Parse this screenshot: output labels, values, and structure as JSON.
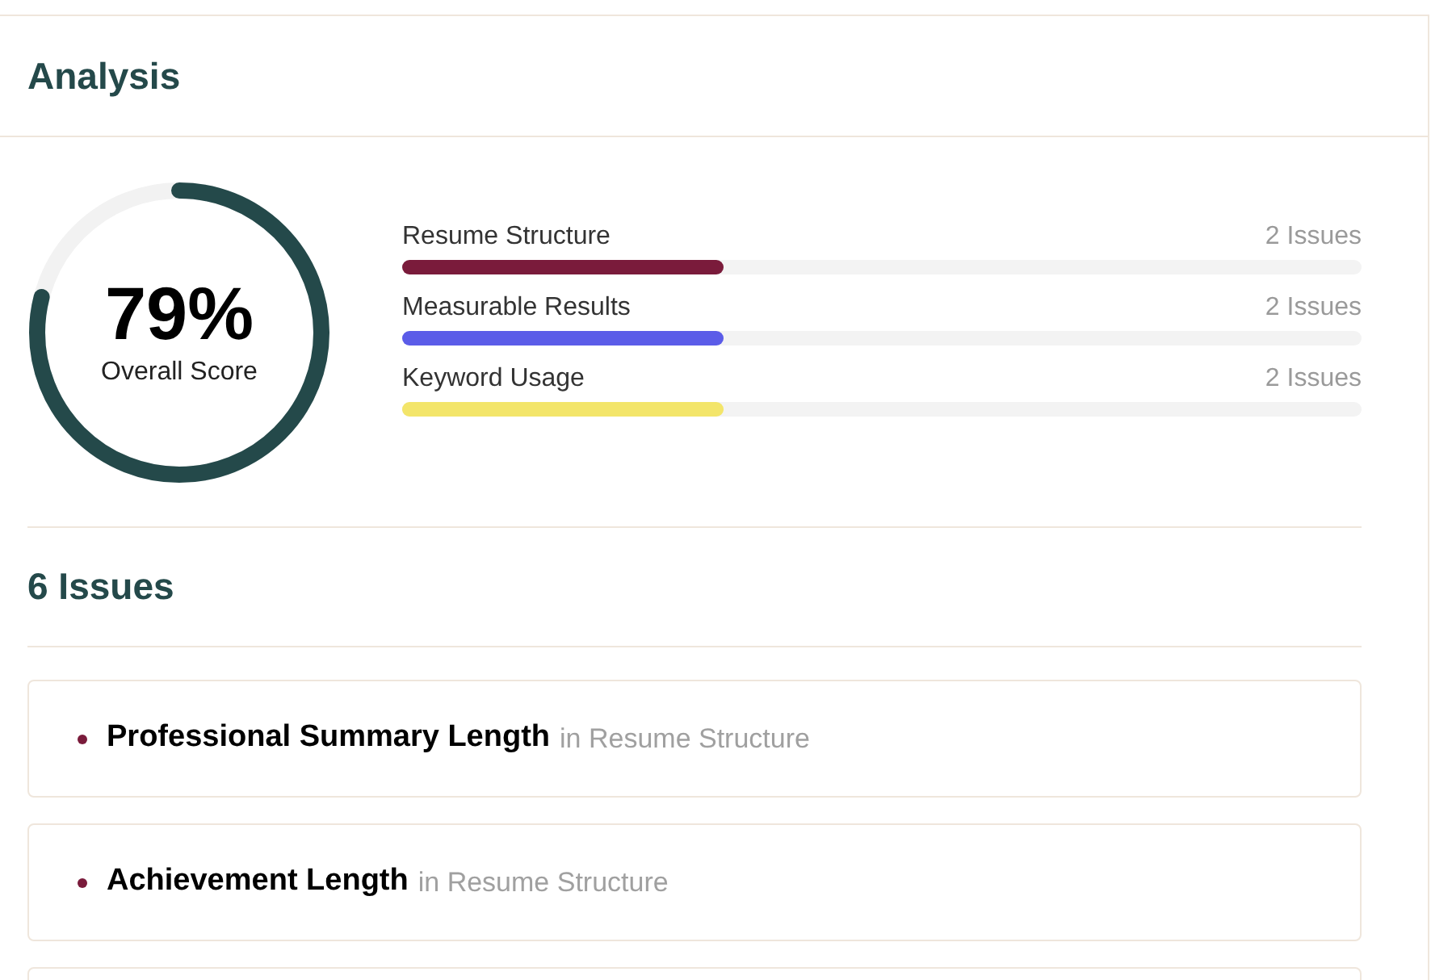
{
  "header": {
    "title": "Analysis"
  },
  "score": {
    "value": "79%",
    "label": "Overall Score",
    "level": 0.79
  },
  "categories": [
    {
      "name": "Resume Structure",
      "issues": "2 Issues",
      "level": 0.335,
      "color": "#7a1b3b"
    },
    {
      "name": "Measurable Results",
      "issues": "2 Issues",
      "level": 0.335,
      "color": "#5b5ce8"
    },
    {
      "name": "Keyword Usage",
      "issues": "2 Issues",
      "level": 0.335,
      "color": "#f3e56a"
    }
  ],
  "issues_heading": "6 Issues",
  "issues": [
    {
      "title": "Professional Summary Length",
      "context": "in Resume Structure",
      "color": "#7a1b3b"
    },
    {
      "title": "Achievement Length",
      "context": "in Resume Structure",
      "color": "#7a1b3b"
    }
  ]
}
